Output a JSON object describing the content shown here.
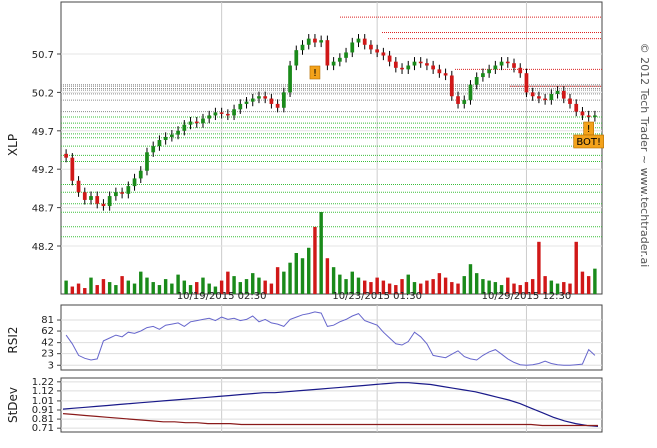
{
  "chart_data": [
    {
      "type": "candlestick",
      "ylabel": "XLP",
      "y_ticks": [
        "50.7",
        "50.2",
        "49.7",
        "49.2",
        "48.7",
        "48.2"
      ],
      "y_tick_values": [
        50.7,
        50.2,
        49.7,
        49.2,
        48.7,
        48.2
      ],
      "ylim": [
        47.68,
        51.22
      ],
      "x_tick_labels": [
        "10/19/2015 02:30",
        "10/23/2015 01:30",
        "10/29/2015 12:30"
      ],
      "x_tick_index": [
        25,
        50,
        74
      ],
      "bar_count": 86,
      "close_series": [
        49.35,
        49.05,
        48.9,
        48.8,
        48.85,
        48.75,
        48.72,
        48.85,
        48.9,
        48.88,
        48.98,
        49.08,
        49.18,
        49.42,
        49.5,
        49.58,
        49.62,
        49.65,
        49.7,
        49.78,
        49.82,
        49.8,
        49.86,
        49.9,
        49.94,
        49.92,
        49.9,
        49.98,
        50.05,
        50.08,
        50.12,
        50.15,
        50.12,
        50.05,
        50.0,
        50.2,
        50.55,
        50.75,
        50.82,
        50.9,
        50.85,
        50.88,
        50.55,
        50.6,
        50.65,
        50.72,
        50.85,
        50.9,
        50.82,
        50.76,
        50.72,
        50.68,
        50.6,
        50.52,
        50.5,
        50.55,
        50.6,
        50.58,
        50.55,
        50.5,
        50.45,
        50.42,
        50.15,
        50.05,
        50.1,
        50.3,
        50.4,
        50.45,
        50.5,
        50.55,
        50.6,
        50.58,
        50.52,
        50.45,
        50.2,
        50.15,
        50.12,
        50.1,
        50.18,
        50.22,
        50.12,
        50.05,
        49.95,
        49.9,
        49.88,
        49.9
      ],
      "volume_series": [
        18,
        10,
        14,
        8,
        22,
        12,
        20,
        16,
        12,
        24,
        18,
        14,
        30,
        22,
        16,
        12,
        20,
        14,
        26,
        18,
        12,
        16,
        22,
        14,
        10,
        18,
        30,
        24,
        16,
        20,
        28,
        22,
        18,
        14,
        36,
        30,
        42,
        55,
        48,
        62,
        90,
        110,
        48,
        36,
        26,
        20,
        30,
        22,
        18,
        16,
        22,
        18,
        14,
        12,
        20,
        26,
        16,
        14,
        18,
        20,
        28,
        22,
        16,
        14,
        24,
        40,
        28,
        20,
        18,
        16,
        12,
        22,
        14,
        12,
        16,
        20,
        70,
        24,
        18,
        14,
        16,
        14,
        70,
        30,
        24,
        34
      ],
      "horizontal_levels": {
        "red": [
          51.18,
          50.98,
          50.9,
          50.5,
          50.28
        ],
        "gray": [
          50.3,
          50.28,
          50.25,
          50.23,
          50.18,
          50.1,
          49.95
        ],
        "green": [
          49.88,
          49.8,
          49.74,
          49.66,
          49.61,
          49.5,
          49.38,
          49.3,
          49.0,
          48.9,
          48.75,
          48.64,
          48.45,
          48.32
        ]
      },
      "markers": [
        {
          "index": 40,
          "label": "!",
          "color": "#f3a21b"
        },
        {
          "index": 84,
          "label": "!",
          "color": "#f3a21b"
        },
        {
          "index": 84,
          "label": "BOT!",
          "color": "#f3a21b"
        }
      ],
      "colors": {
        "up": "#1a8a1a",
        "down": "#d01818",
        "wick": "#000000"
      }
    },
    {
      "type": "line",
      "ylabel": "RSI2",
      "y_ticks": [
        "81",
        "62",
        "42",
        "23",
        "3"
      ],
      "y_tick_values": [
        81,
        62,
        42,
        23,
        3
      ],
      "ylim": [
        0,
        100
      ],
      "color": "#6666cc",
      "values": [
        55,
        40,
        20,
        15,
        12,
        14,
        45,
        50,
        55,
        52,
        60,
        58,
        62,
        68,
        70,
        65,
        72,
        74,
        76,
        70,
        78,
        80,
        82,
        84,
        80,
        86,
        82,
        84,
        80,
        82,
        88,
        78,
        82,
        76,
        74,
        70,
        82,
        86,
        90,
        92,
        95,
        93,
        70,
        72,
        78,
        82,
        88,
        92,
        80,
        76,
        72,
        60,
        50,
        40,
        38,
        44,
        60,
        52,
        40,
        20,
        18,
        16,
        22,
        28,
        18,
        14,
        12,
        20,
        26,
        30,
        22,
        14,
        8,
        4,
        3,
        4,
        6,
        10,
        6,
        4,
        3,
        3,
        4,
        5,
        30,
        20
      ]
    },
    {
      "type": "line",
      "ylabel": "StDev",
      "y_ticks": [
        "1.22",
        "1.12",
        "1.01",
        "0.91",
        "0.81",
        "0.71"
      ],
      "y_tick_values": [
        1.22,
        1.12,
        1.01,
        0.91,
        0.81,
        0.71
      ],
      "ylim": [
        0.69,
        1.24
      ],
      "series": [
        {
          "color": "#1a1a8a",
          "values": [
            0.92,
            0.93,
            0.94,
            0.95,
            0.96,
            0.97,
            0.98,
            0.99,
            1.0,
            1.01,
            1.02,
            1.03,
            1.04,
            1.05,
            1.06,
            1.07,
            1.08,
            1.09,
            1.1,
            1.1,
            1.11,
            1.12,
            1.13,
            1.14,
            1.15,
            1.16,
            1.17,
            1.18,
            1.19,
            1.2,
            1.21,
            1.21,
            1.2,
            1.19,
            1.17,
            1.15,
            1.13,
            1.11,
            1.08,
            1.05,
            1.02,
            0.98,
            0.93,
            0.88,
            0.83,
            0.79,
            0.76,
            0.74,
            0.73
          ]
        },
        {
          "color": "#8a1a1a",
          "values": [
            0.87,
            0.86,
            0.85,
            0.84,
            0.83,
            0.82,
            0.81,
            0.8,
            0.79,
            0.78,
            0.78,
            0.77,
            0.77,
            0.76,
            0.76,
            0.76,
            0.75,
            0.75,
            0.75,
            0.75,
            0.75,
            0.75,
            0.75,
            0.75,
            0.75,
            0.75,
            0.75,
            0.75,
            0.75,
            0.75,
            0.75,
            0.75,
            0.75,
            0.75,
            0.75,
            0.75,
            0.75,
            0.75,
            0.75,
            0.75,
            0.75,
            0.75,
            0.75,
            0.74,
            0.74,
            0.74,
            0.74,
            0.74,
            0.74
          ]
        }
      ]
    }
  ],
  "watermark": "© 2012 Tech Trader ~ www.techtrader.ai"
}
